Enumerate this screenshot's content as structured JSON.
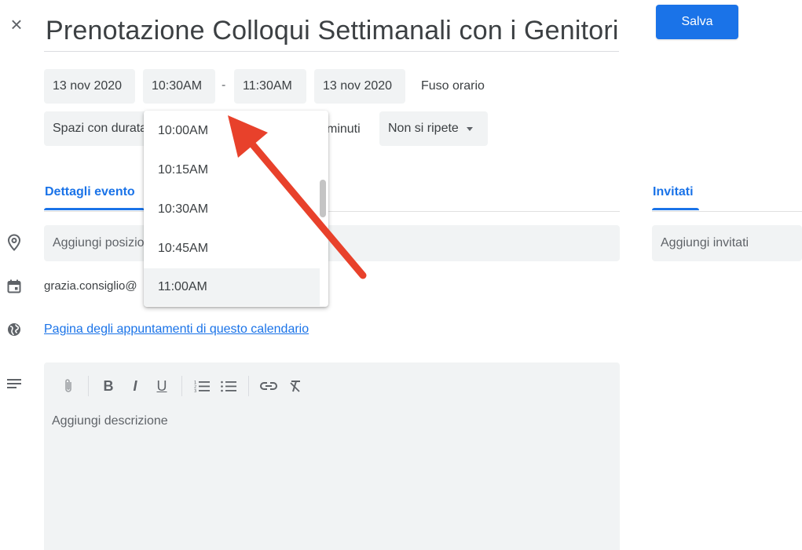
{
  "header": {
    "close_icon": "close-icon",
    "title": "Prenotazione Colloqui Settimanali con i Genitori",
    "save_label": "Salva"
  },
  "datetime": {
    "start_date": "13 nov 2020",
    "start_time": "10:30AM",
    "separator": "-",
    "end_time": "11:30AM",
    "end_date": "13 nov 2020",
    "timezone_label": "Fuso orario"
  },
  "options": {
    "slots_label": "Spazi con durata di",
    "minutes_label": "minuti",
    "repeat_label": "Non si ripete"
  },
  "tabs": {
    "details": "Dettagli evento",
    "guests": "Invitati"
  },
  "fields": {
    "location_placeholder": "Aggiungi posizione",
    "calendar_owner": "grazia.consiglio@",
    "booking_page_link": "Pagina degli appuntamenti di questo calendario",
    "guests_placeholder": "Aggiungi invitati"
  },
  "editor": {
    "toolbar": {
      "attach": "📎",
      "bold": "B",
      "italic": "I",
      "underline": "U",
      "numbered_list": "⒈",
      "bulleted_list": "☰",
      "link": "⊖",
      "clear_format": "T̸"
    },
    "description_placeholder": "Aggiungi descrizione"
  },
  "time_dropdown": {
    "options": [
      "10:00AM",
      "10:15AM",
      "10:30AM",
      "10:45AM",
      "11:00AM"
    ],
    "hovered_option": "11:00AM"
  },
  "colors": {
    "accent": "#1a73e8",
    "chip_bg": "#f1f3f4",
    "annotation_arrow": "#e8412b"
  }
}
